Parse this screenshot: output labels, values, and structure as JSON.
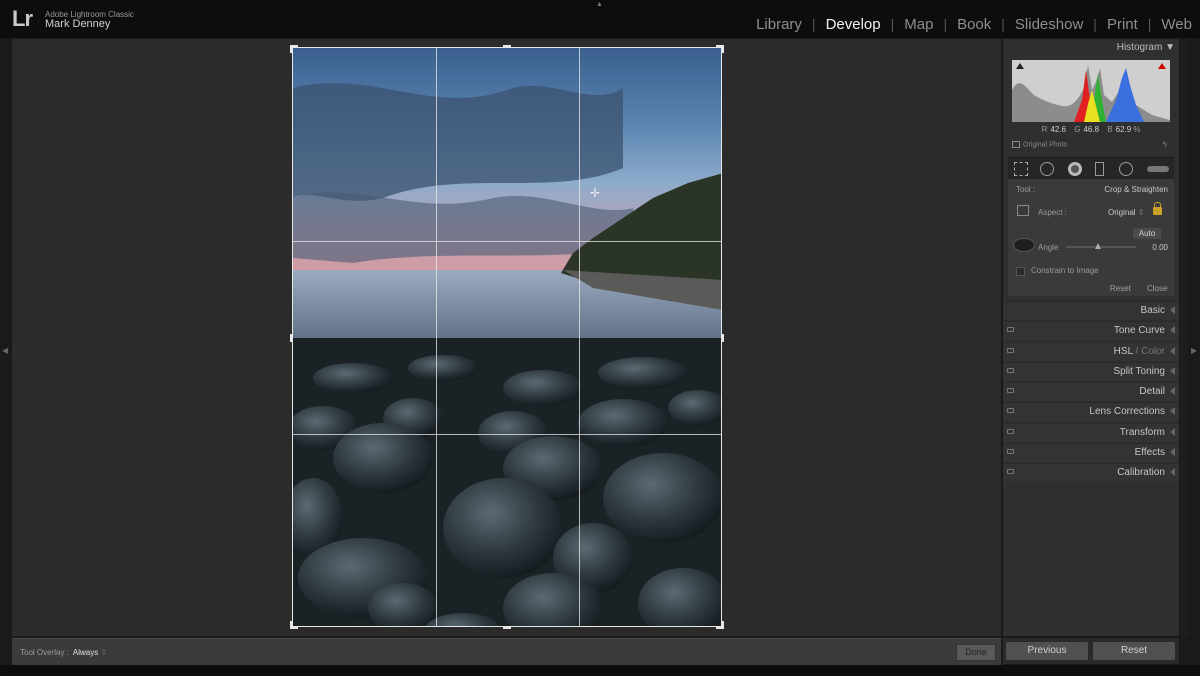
{
  "app": {
    "logo": "Lr",
    "name": "Adobe Lightroom Classic",
    "user": "Mark Denney"
  },
  "modules": [
    "Library",
    "Develop",
    "Map",
    "Book",
    "Slideshow",
    "Print",
    "Web"
  ],
  "active_module": "Develop",
  "histogram": {
    "title": "Histogram",
    "r_label": "R",
    "r_value": "42.6",
    "g_label": "G",
    "g_value": "46.8",
    "b_label": "B",
    "b_value": "62.9",
    "percent": "%",
    "original_photo": "Original Photo"
  },
  "crop": {
    "tool_label": "Tool :",
    "tool_name": "Crop & Straighten",
    "aspect_label": "Aspect :",
    "aspect_value": "Original",
    "auto_label": "Auto",
    "angle_label": "Angle",
    "angle_value": "0.00",
    "constrain_label": "Constrain to Image",
    "reset_label": "Reset",
    "close_label": "Close"
  },
  "sections": [
    {
      "title": "Basic",
      "dim": "",
      "switch": false
    },
    {
      "title": "Tone Curve",
      "dim": "",
      "switch": true
    },
    {
      "title": "HSL",
      "dim": " / Color",
      "switch": true
    },
    {
      "title": "Split Toning",
      "dim": "",
      "switch": true
    },
    {
      "title": "Detail",
      "dim": "",
      "switch": true
    },
    {
      "title": "Lens Corrections",
      "dim": "",
      "switch": true
    },
    {
      "title": "Transform",
      "dim": "",
      "switch": true
    },
    {
      "title": "Effects",
      "dim": "",
      "switch": true
    },
    {
      "title": "Calibration",
      "dim": "",
      "switch": true
    }
  ],
  "toolbar": {
    "overlay_label": "Tool Overlay :",
    "overlay_value": "Always",
    "done_label": "Done"
  },
  "bottom_buttons": {
    "previous": "Previous",
    "reset": "Reset"
  },
  "colors": {
    "accent_lock": "#c9a227",
    "histogram_red": "#e02020",
    "histogram_green": "#30b030",
    "histogram_blue": "#3a6fe0",
    "histogram_yellow": "#e8e020"
  },
  "icons": {
    "crop_tool": "crop-overlay-icon",
    "spot_removal": "spot-removal-icon",
    "red_eye": "red-eye-icon",
    "graduated_filter": "graduated-filter-icon",
    "radial_filter": "radial-filter-icon",
    "adjustment_brush": "adjustment-brush-icon"
  }
}
